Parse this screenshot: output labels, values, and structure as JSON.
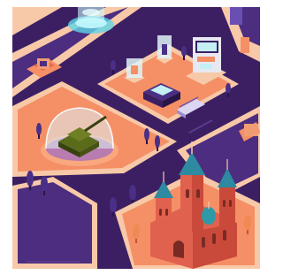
{
  "scene": {
    "description_free": true,
    "palette": {
      "road": "#3c1f63",
      "roadEdge": "#2a1548",
      "sidewalk": "#f7c9a8",
      "plaza": "#f58f66",
      "plazaLight": "#f9a77f",
      "grass": "#4c2d7f",
      "tree": "#4a2f86",
      "treeOrange": "#f08a55",
      "tank": "#5b6b1c",
      "tankDark": "#38420f",
      "dome": "#dff3f7",
      "church": "#e0614e",
      "churchRoof": "#2e8aa0",
      "churchDome": "#2e9aa8",
      "screen": "#c4f0f4"
    },
    "icons": [
      "hologram-pedestal-icon",
      "museum-display-case-icon",
      "military-tank-exhibit-icon",
      "cathedral-building-icon",
      "kiosk-terminal-icon",
      "bench-icon",
      "tree-icon"
    ]
  }
}
